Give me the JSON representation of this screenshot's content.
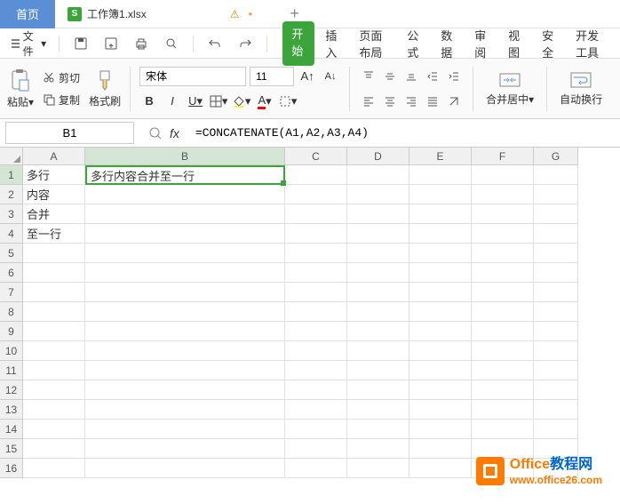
{
  "tabs": {
    "home": "首页",
    "file_icon": "S",
    "filename": "工作簿1.xlsx",
    "warning": "⚠",
    "dot": "●",
    "plus": "+"
  },
  "file_menu": "文件",
  "menu": {
    "start": "开始",
    "insert": "插入",
    "page_layout": "页面布局",
    "formula": "公式",
    "data": "数据",
    "review": "审阅",
    "view": "视图",
    "security": "安全",
    "dev_tools": "开发工具"
  },
  "ribbon": {
    "paste": "粘贴",
    "cut": "剪切",
    "copy": "复制",
    "format_painter": "格式刷",
    "font_name": "宋体",
    "font_size": "11",
    "merge": "合并居中",
    "wrap": "自动换行"
  },
  "formula_bar": {
    "name_box": "B1",
    "fx": "fx",
    "formula": "=CONCATENATE(A1,A2,A3,A4)"
  },
  "columns": [
    "A",
    "B",
    "C",
    "D",
    "E",
    "F",
    "G"
  ],
  "rows": [
    "1",
    "2",
    "3",
    "4",
    "5",
    "6",
    "7",
    "8",
    "9",
    "10",
    "11",
    "12",
    "13",
    "14",
    "15",
    "16"
  ],
  "cells": {
    "A1": "多行",
    "A2": "内容",
    "A3": "合并",
    "A4": "至一行",
    "B1": "多行内容合并至一行"
  },
  "watermark": {
    "title_orange": "Office",
    "title_blue": "教程网",
    "url": "www.office26.com"
  }
}
